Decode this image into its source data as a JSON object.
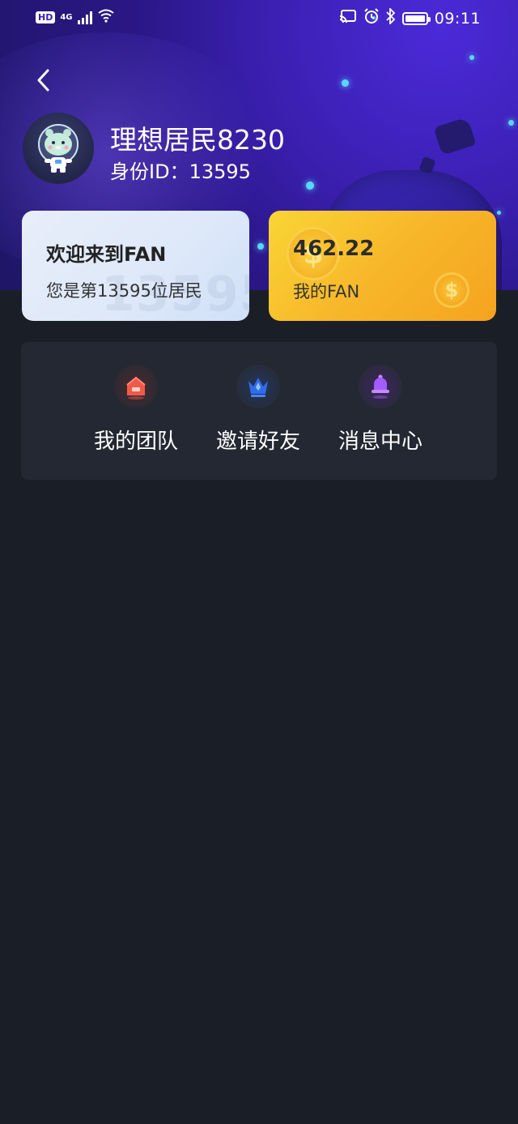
{
  "status_bar": {
    "hd": "HD",
    "network": "4G",
    "time": "09:11",
    "icons": [
      "signal-icon",
      "wifi-icon",
      "cast-icon",
      "alarm-icon",
      "bluetooth-icon",
      "battery-icon"
    ]
  },
  "profile": {
    "username": "理想居民8230",
    "id_label": "身份ID：",
    "id_value": "13595"
  },
  "welcome_card": {
    "title": "欢迎来到FAN",
    "subtitle": "您是第13595位居民",
    "watermark": "13595"
  },
  "fan_card": {
    "value": "462.22",
    "label": "我的FAN"
  },
  "menu": {
    "items": [
      {
        "label": "我的团队",
        "icon": "house-icon",
        "color": "#e94b3c"
      },
      {
        "label": "邀请好友",
        "icon": "crown-icon",
        "color": "#3a7bff"
      },
      {
        "label": "消息中心",
        "icon": "bell-icon",
        "color": "#a04bff"
      }
    ]
  },
  "colors": {
    "background": "#1a1f27",
    "panel": "#232832",
    "banner": "#3a1fb0",
    "fan_card": "#f7b72a",
    "welcome_card": "#dde8f9"
  }
}
